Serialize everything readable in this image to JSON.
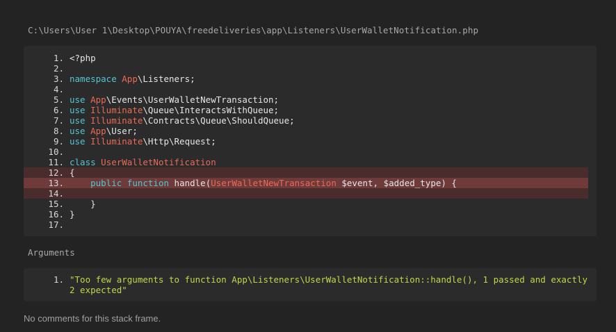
{
  "frame": {
    "file_path": "C:\\Users\\User 1\\Desktop\\POUYA\\freedeliveries\\app\\Listeners\\UserWalletNotification.php",
    "highlighted_line": "13.",
    "code_lines": [
      {
        "num": "1.",
        "tokens": [
          {
            "t": "<?php"
          }
        ]
      },
      {
        "num": "2.",
        "tokens": []
      },
      {
        "num": "3.",
        "tokens": [
          {
            "t": "namespace",
            "c": "kw"
          },
          {
            "t": " "
          },
          {
            "t": "App",
            "c": "cls"
          },
          {
            "t": "\\Listeners;"
          }
        ]
      },
      {
        "num": "4.",
        "tokens": []
      },
      {
        "num": "5.",
        "tokens": [
          {
            "t": "use",
            "c": "kw"
          },
          {
            "t": " "
          },
          {
            "t": "App",
            "c": "cls"
          },
          {
            "t": "\\Events\\UserWalletNewTransaction;"
          }
        ]
      },
      {
        "num": "6.",
        "tokens": [
          {
            "t": "use",
            "c": "kw"
          },
          {
            "t": " "
          },
          {
            "t": "Illuminate",
            "c": "cls"
          },
          {
            "t": "\\Queue\\InteractsWithQueue;"
          }
        ]
      },
      {
        "num": "7.",
        "tokens": [
          {
            "t": "use",
            "c": "kw"
          },
          {
            "t": " "
          },
          {
            "t": "Illuminate",
            "c": "cls"
          },
          {
            "t": "\\Contracts\\Queue\\ShouldQueue;"
          }
        ]
      },
      {
        "num": "8.",
        "tokens": [
          {
            "t": "use",
            "c": "kw"
          },
          {
            "t": " "
          },
          {
            "t": "App",
            "c": "cls"
          },
          {
            "t": "\\User;"
          }
        ]
      },
      {
        "num": "9.",
        "tokens": [
          {
            "t": "use",
            "c": "kw"
          },
          {
            "t": " "
          },
          {
            "t": "Illuminate",
            "c": "cls"
          },
          {
            "t": "\\Http\\Request;"
          }
        ]
      },
      {
        "num": "10.",
        "tokens": []
      },
      {
        "num": "11.",
        "tokens": [
          {
            "t": "class",
            "c": "kw"
          },
          {
            "t": " "
          },
          {
            "t": "UserWalletNotification",
            "c": "cls"
          }
        ]
      },
      {
        "num": "12.",
        "tokens": [
          {
            "t": "{"
          }
        ],
        "hl": "soft"
      },
      {
        "num": "13.",
        "tokens": [
          {
            "t": "    "
          },
          {
            "t": "public",
            "c": "kw"
          },
          {
            "t": " "
          },
          {
            "t": "function",
            "c": "kw"
          },
          {
            "t": " handle("
          },
          {
            "t": "UserWalletNewTransaction",
            "c": "cls"
          },
          {
            "t": " $event, $added_type) {"
          }
        ],
        "hl": "strong"
      },
      {
        "num": "14.",
        "tokens": [],
        "hl": "soft"
      },
      {
        "num": "15.",
        "tokens": [
          {
            "t": "    }"
          }
        ]
      },
      {
        "num": "16.",
        "tokens": [
          {
            "t": "}"
          }
        ]
      },
      {
        "num": "17.",
        "tokens": []
      }
    ],
    "colors": {
      "background": "#232323",
      "panel": "#2b2b2b",
      "keyword": "#53c6d2",
      "class_name": "#ec6a55",
      "string": "#c3d64a",
      "highlight_soft": "#4a2c2c",
      "highlight_strong": "#6e3a3a"
    }
  },
  "arguments": {
    "heading": "Arguments",
    "items": [
      {
        "num": "1.",
        "text": "\"Too few arguments to function App\\Listeners\\UserWalletNotification::handle(), 1 passed and exactly 2 expected\""
      }
    ]
  },
  "comments": {
    "empty_text": "No comments for this stack frame."
  }
}
